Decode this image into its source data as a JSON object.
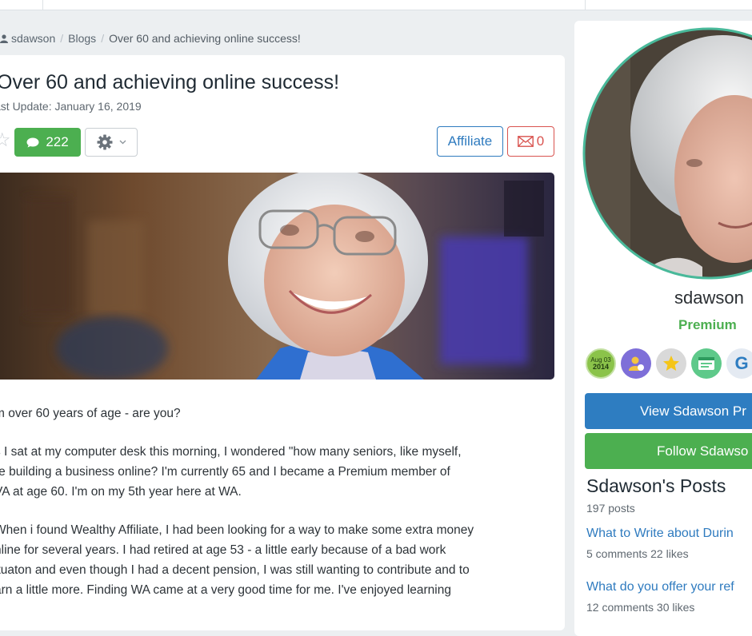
{
  "breadcrumb": {
    "user": "sdawson",
    "blogs": "Blogs",
    "current": "Over 60 and achieving online success!"
  },
  "article": {
    "title": "Over 60 and achieving online success!",
    "last_update": "ast Update: January 16, 2019",
    "comment_count": "222",
    "affiliate_label": "Affiliate",
    "message_count": "0",
    "paragraphs": [
      [
        "m over 60 years of age - are you?"
      ],
      [
        "s I sat at my computer desk this morning, I wondered \"how many seniors, like myself,",
        "re building a business online? I'm currently 65 and I became a Premium member of",
        "VA at age 60. I'm on my 5th year here at WA."
      ],
      [
        "When i found Wealthy Affiliate, I had been looking for a way to make some extra money",
        "nline for several years. I had retired at age 53 - a little early because of a bad work",
        "ituaton and even though I had a decent pension, I was still wanting to contribute and to",
        "arn a little more. Finding WA came at a very good time for me. I've enjoyed learning"
      ]
    ]
  },
  "sidebar": {
    "username": "sdawson",
    "membership": "Premium",
    "badges": {
      "join_date_line1": "Aug 03",
      "join_date_line2": "2014",
      "letter_badge": "G"
    },
    "view_profile_label": "View Sdawson Pr",
    "follow_label": "Follow Sdawso",
    "posts_heading": "Sdawson's Posts",
    "posts_count": "197 posts",
    "posts": [
      {
        "title": "What to Write about Durin",
        "meta": "5 comments  22 likes"
      },
      {
        "title": "What do you offer your ref",
        "meta": "12 comments  30 likes"
      }
    ]
  },
  "colors": {
    "accent_green": "#4caf50",
    "accent_blue": "#2e7dc1",
    "accent_red": "#d9534f",
    "avatar_ring": "#49b99a"
  },
  "icons": [
    "user-icon",
    "star-icon",
    "comment-icon",
    "gear-icon",
    "chevron-down-icon",
    "mail-icon"
  ]
}
